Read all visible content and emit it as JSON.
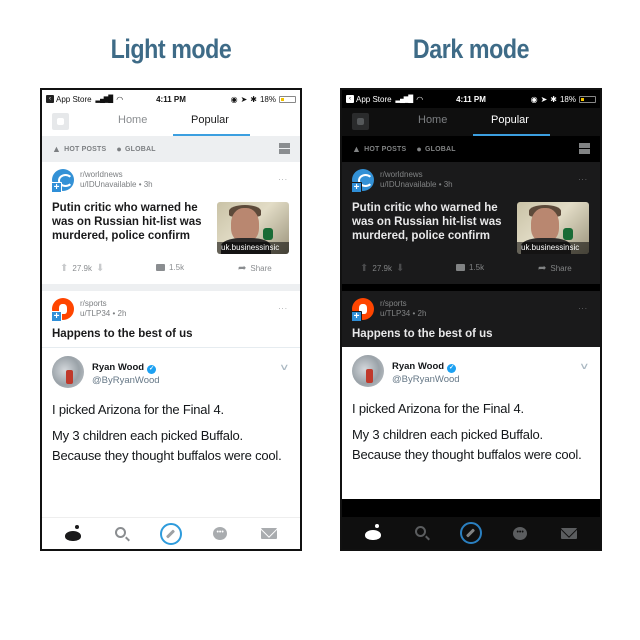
{
  "titles": {
    "light": "Light mode",
    "dark": "Dark mode"
  },
  "phone": {
    "status_bar": {
      "back_label": "App Store",
      "back_icon": "back-arrow-icon",
      "signal_icon": "signal-bars-icon",
      "wifi_icon": "wifi-icon",
      "time": "4:11 PM",
      "right_icons": [
        "screen-lock-icon",
        "location-arrow-icon",
        "bluetooth-icon"
      ],
      "battery": "18%",
      "battery_level_fraction": 0.18
    },
    "nav": {
      "avatar_icon": "user-avatar-icon",
      "tabs": [
        {
          "label": "Home",
          "active": false
        },
        {
          "label": "Popular",
          "active": true
        }
      ],
      "accent_color": "#3c9fe0"
    },
    "sort_bar": {
      "sort_label": "HOT POSTS",
      "sort_icon": "flame-icon",
      "location_label": "GLOBAL",
      "location_icon": "map-pin-icon",
      "layout_icon": "card-layout-icon"
    },
    "posts": [
      {
        "subreddit": "r/worldnews",
        "user": "u/IDUnavailable",
        "age": "3h",
        "meta": "u/IDUnavailable • 3h",
        "title": "Putin critic who warned he was on Russian hit-list was murdered, police confirm",
        "thumbnail_domain": "uk.businessinsic",
        "upvotes": "27.9k",
        "comments": "1.5k",
        "share_label": "Share",
        "more_label": "..."
      },
      {
        "subreddit": "r/sports",
        "user": "u/TLP34",
        "age": "2h",
        "meta": "u/TLP34 • 2h",
        "title": "Happens to the best of us",
        "more_label": "..."
      }
    ],
    "tweet": {
      "name": "Ryan Wood",
      "verified": true,
      "handle": "@ByRyanWood",
      "paragraphs": [
        "I picked Arizona for the Final 4.",
        "My 3 children each picked Buffalo. Because they thought buffalos were cool."
      ]
    },
    "tab_bar": {
      "items": [
        "home-snoo-icon",
        "search-icon",
        "compose-post-icon",
        "chat-icon",
        "inbox-mail-icon"
      ],
      "chat_glyph": "•••"
    }
  },
  "colors": {
    "title": "#3e6b87",
    "accent_blue": "#3c9fe0",
    "reddit_orange": "#ff4500",
    "twitter_blue": "#1da1f2",
    "battery_yellow": "#f2c200"
  }
}
